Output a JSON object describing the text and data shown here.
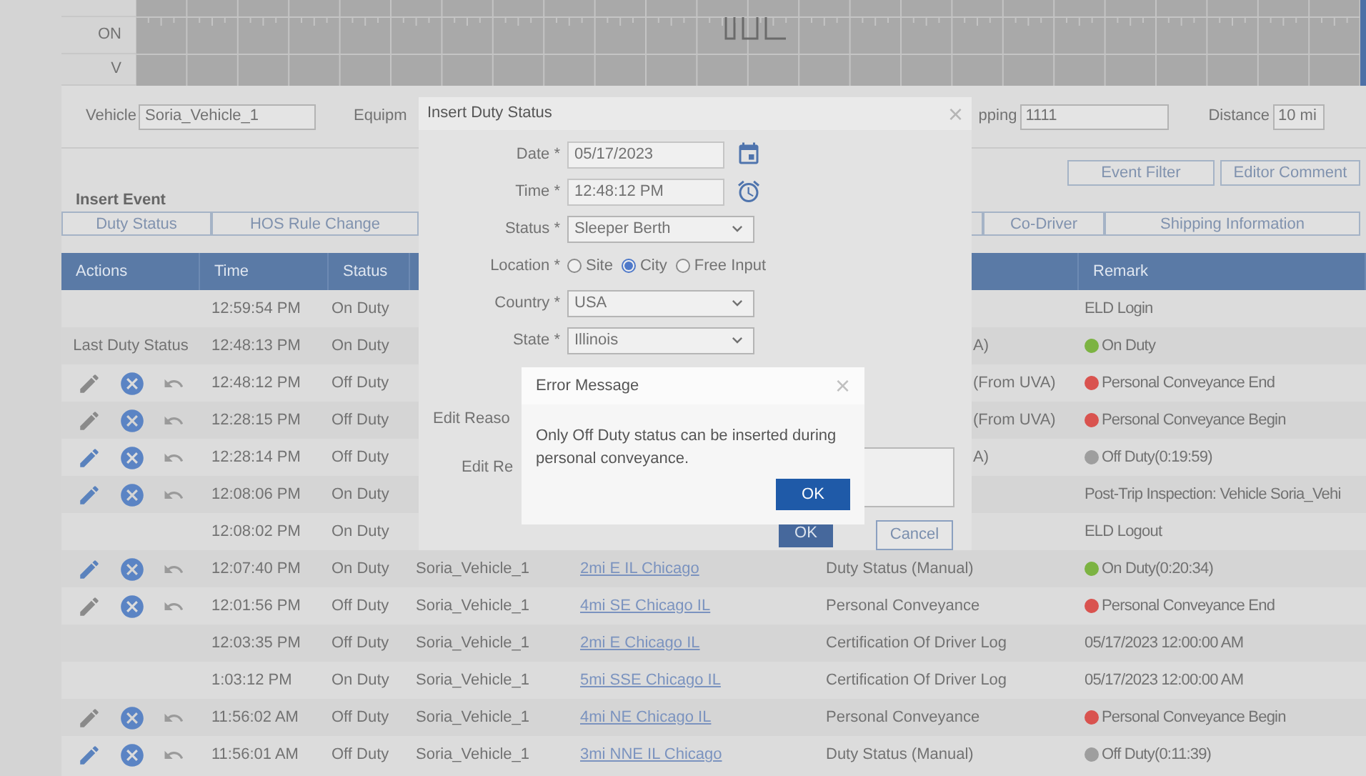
{
  "chart": {
    "row_labels": [
      "ON",
      "V"
    ]
  },
  "vehicle_bar": {
    "vehicle_label": "Vehicle",
    "vehicle_value": "Soria_Vehicle_1",
    "equipment_label": "Equipm",
    "shipping_label": "pping",
    "shipping_value": "1111",
    "distance_label": "Distance",
    "distance_value": "10 mi"
  },
  "toolbar": {
    "buttons": [
      "Event Filter",
      "Editor Comment"
    ]
  },
  "insert_event": {
    "title": "Insert Event",
    "tabs": [
      {
        "label": "Duty Status"
      },
      {
        "label": "HOS Rule Change"
      },
      {
        "label": "Co-Driver"
      },
      {
        "label": "Shipping Information"
      }
    ]
  },
  "table": {
    "columns": [
      "Actions",
      "Time",
      "Status",
      "Remark"
    ],
    "rows": [
      {
        "actions": {
          "kind": "none"
        },
        "time": "12:59:54 PM",
        "status": "On Duty",
        "remark": "ELD Login"
      },
      {
        "actions": {
          "kind": "text",
          "text": "Last Duty Status"
        },
        "time": "12:48:13 PM",
        "status": "On Duty",
        "event": "A)",
        "remark": "On Duty",
        "color": "#7cb342"
      },
      {
        "actions": {
          "kind": "icons",
          "pencil_active": false
        },
        "time": "12:48:12 PM",
        "status": "Off Duty",
        "event": "(From UVA)",
        "remark": "Personal Conveyance End",
        "color": "#d9534f"
      },
      {
        "actions": {
          "kind": "icons",
          "pencil_active": false
        },
        "time": "12:28:15 PM",
        "status": "Off Duty",
        "event": "(From UVA)",
        "remark": "Personal Conveyance Begin",
        "color": "#d9534f"
      },
      {
        "actions": {
          "kind": "icons",
          "pencil_active": true
        },
        "time": "12:28:14 PM",
        "status": "Off Duty",
        "event": "A)",
        "remark": "Off Duty(0:19:59)",
        "color": "#9e9e9e"
      },
      {
        "actions": {
          "kind": "icons",
          "pencil_active": true
        },
        "time": "12:08:06 PM",
        "status": "On Duty",
        "remark": "Post-Trip Inspection: Vehicle Soria_Vehi"
      },
      {
        "actions": {
          "kind": "none"
        },
        "time": "12:08:02 PM",
        "status": "On Duty",
        "remark": "ELD Logout"
      },
      {
        "actions": {
          "kind": "icons",
          "pencil_active": true
        },
        "time": "12:07:40 PM",
        "status": "On Duty",
        "vehicle": "Soria_Vehicle_1",
        "location": "2mi E IL Chicago",
        "event": "Duty Status (Manual)",
        "remark": "On Duty(0:20:34)",
        "color": "#7cb342"
      },
      {
        "actions": {
          "kind": "icons",
          "pencil_active": false
        },
        "time": "12:01:56 PM",
        "status": "Off Duty",
        "vehicle": "Soria_Vehicle_1",
        "location": "4mi SE Chicago IL",
        "event": "Personal Conveyance",
        "remark": "Personal Conveyance End",
        "color": "#d9534f"
      },
      {
        "actions": {
          "kind": "none"
        },
        "time": "12:03:35 PM",
        "status": "Off Duty",
        "vehicle": "Soria_Vehicle_1",
        "location": "2mi E Chicago IL",
        "event": "Certification Of Driver Log",
        "remark": "05/17/2023 12:00:00 AM"
      },
      {
        "actions": {
          "kind": "none"
        },
        "time": "1:03:12 PM",
        "status": "On Duty",
        "vehicle": "Soria_Vehicle_1",
        "location": "5mi SSE Chicago IL",
        "event": "Certification Of Driver Log",
        "remark": "05/17/2023 12:00:00 AM"
      },
      {
        "actions": {
          "kind": "icons",
          "pencil_active": false
        },
        "time": "11:56:02 AM",
        "status": "Off Duty",
        "vehicle": "Soria_Vehicle_1",
        "location": "4mi NE Chicago IL",
        "event": "Personal Conveyance",
        "remark": "Personal Conveyance Begin",
        "color": "#d9534f"
      },
      {
        "actions": {
          "kind": "icons",
          "pencil_active": true
        },
        "time": "11:56:01 AM",
        "status": "Off Duty",
        "vehicle": "Soria_Vehicle_1",
        "location": "3mi NNE IL Chicago",
        "event": "Duty Status (Manual)",
        "remark": "Off Duty(0:11:39)",
        "color": "#9e9e9e"
      }
    ]
  },
  "insert_dialog": {
    "title": "Insert Duty Status",
    "close": "×",
    "fields": [
      {
        "kind": "date",
        "label": "Date *",
        "value": "05/17/2023"
      },
      {
        "kind": "time",
        "label": "Time *",
        "value": "12:48:12 PM"
      },
      {
        "kind": "select",
        "label": "Status *",
        "value": "Sleeper Berth"
      },
      {
        "kind": "radio",
        "label": "Location *",
        "options": [
          {
            "label": "Site",
            "selected": false
          },
          {
            "label": "City",
            "selected": true
          },
          {
            "label": "Free Input",
            "selected": false
          }
        ]
      },
      {
        "kind": "select",
        "label": "Country *",
        "value": "USA"
      },
      {
        "kind": "select",
        "label": "State *",
        "value": "Illinois"
      },
      {
        "kind": "reason",
        "label": "Edit Reaso"
      },
      {
        "kind": "textarea",
        "label": "Edit Re"
      }
    ],
    "buttons": [
      "OK",
      "Cancel"
    ]
  },
  "error_dialog": {
    "title": "Error Message",
    "close": "×",
    "message": "Only Off Duty status can be inserted during personal conveyance.",
    "button": "OK"
  }
}
